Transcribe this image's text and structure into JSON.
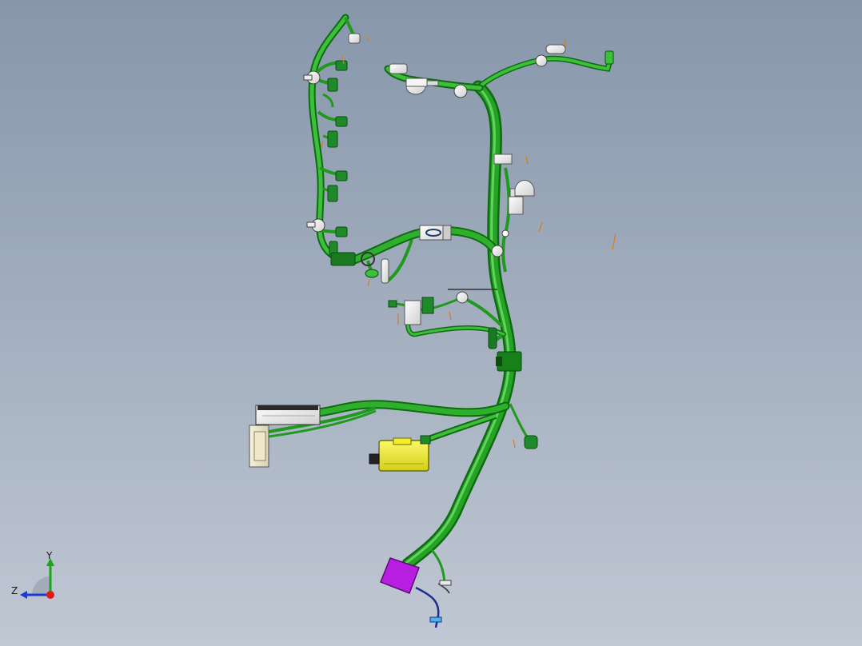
{
  "viewport": {
    "background_top": "#8796ab",
    "background_bottom": "#c0c8d3",
    "model": "engine-wire-harness"
  },
  "colors": {
    "harness": "#1f9a1f",
    "harness_dark": "#0f6a12",
    "harness_light": "#63d25e",
    "connector_green": "#1e8a2a",
    "connector_white": "#f0f0f0",
    "ecu_yellow": "#f2ee2a",
    "grommet_purple": "#b81ee0",
    "dim_orange": "#e07a10",
    "blue_wire": "#1d2f8f"
  },
  "triad": {
    "y_label": "Y",
    "z_label": "Z",
    "y_color": "#1aa51a",
    "z_color": "#1a3bd6",
    "x_color": "#e01a1a"
  }
}
